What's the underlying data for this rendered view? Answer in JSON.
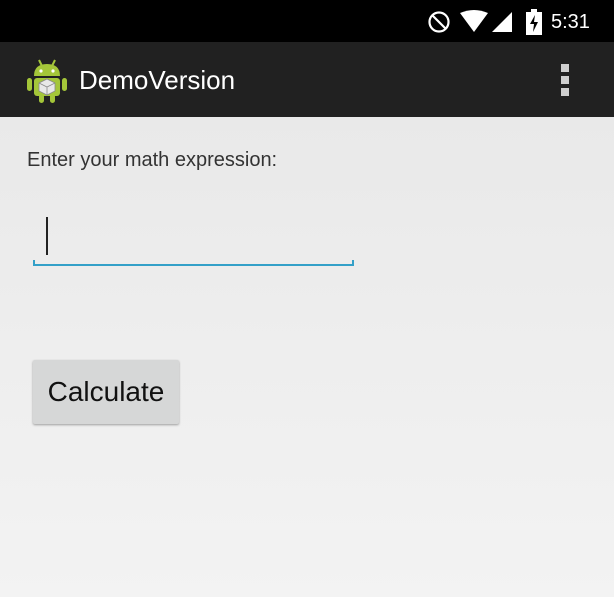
{
  "status_bar": {
    "time": "5:31",
    "icons": [
      "do-not-disturb-icon",
      "wifi-icon",
      "cell-signal-icon",
      "battery-charging-icon"
    ]
  },
  "action_bar": {
    "title": "DemoVersion",
    "app_icon": "android-app-icon",
    "overflow_icon": "overflow-menu-icon"
  },
  "main": {
    "prompt_label": "Enter your math expression:",
    "expression_input": {
      "value": "",
      "placeholder": ""
    },
    "calculate_button_label": "Calculate"
  },
  "colors": {
    "status_bar_bg": "#000000",
    "action_bar_bg": "#212121",
    "content_bg": "#eeeeee",
    "input_accent": "#33a0c8",
    "button_bg": "#d6d7d7",
    "android_green": "#a4c639"
  }
}
